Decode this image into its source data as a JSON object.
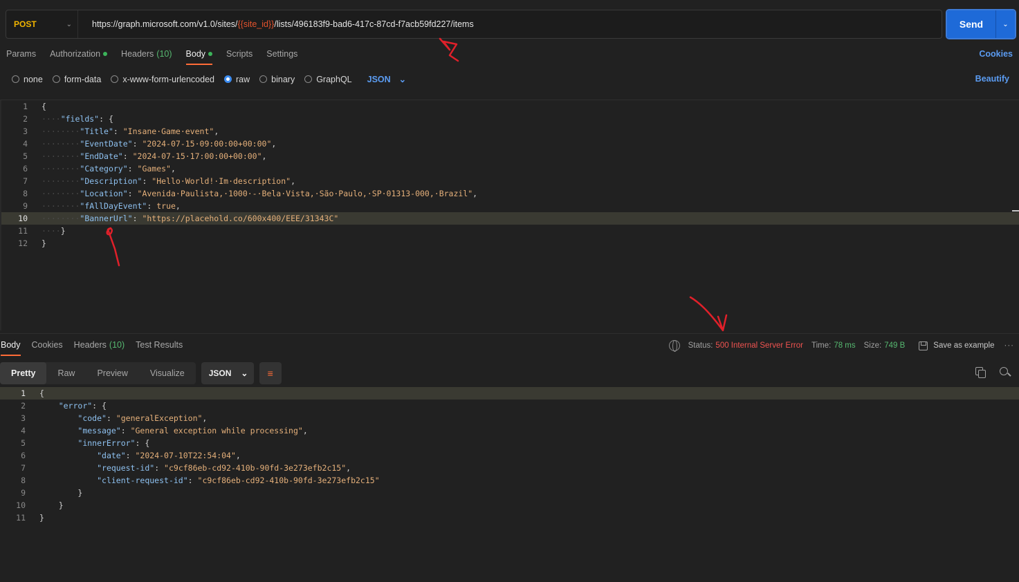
{
  "request": {
    "method": "POST",
    "url_prefix": "https://graph.microsoft.com/v1.0/sites/",
    "url_variable": "{{site_id}}",
    "url_suffix": "/lists/496183f9-bad6-417c-87cd-f7acb59fd227/items",
    "send_label": "Send"
  },
  "request_tabs": [
    {
      "label": "Params"
    },
    {
      "label": "Authorization",
      "dot": true
    },
    {
      "label": "Headers",
      "count": "(10)"
    },
    {
      "label": "Body",
      "dot": true,
      "active": true
    },
    {
      "label": "Scripts"
    },
    {
      "label": "Settings"
    }
  ],
  "cookies_label": "Cookies",
  "body_types": [
    {
      "label": "none",
      "selected": false
    },
    {
      "label": "form-data",
      "selected": false
    },
    {
      "label": "x-www-form-urlencoded",
      "selected": false
    },
    {
      "label": "raw",
      "selected": true
    },
    {
      "label": "binary",
      "selected": false
    },
    {
      "label": "GraphQL",
      "selected": false
    }
  ],
  "raw_format": "JSON",
  "beautify_label": "Beautify",
  "request_body": {
    "fields": [
      {
        "key": "Title",
        "value": "\"Insane Game event\""
      },
      {
        "key": "EventDate",
        "value": "\"2024-07-15 09:00:00+00:00\""
      },
      {
        "key": "EndDate",
        "value": "\"2024-07-15 17:00:00+00:00\""
      },
      {
        "key": "Category",
        "value": "\"Games\""
      },
      {
        "key": "Description",
        "value": "\"Hello World! Im description\""
      },
      {
        "key": "Location",
        "value": "\"Avenida Paulista, 1000 - Bela Vista, São Paulo, SP 01313-000, Brazil\""
      },
      {
        "key": "fAllDayEvent",
        "value": "true"
      },
      {
        "key": "BannerUrl",
        "value": "\"https://placehold.co/600x400/EEE/31343C\""
      }
    ]
  },
  "response_tabs": [
    {
      "label": "Body",
      "active": true
    },
    {
      "label": "Cookies"
    },
    {
      "label": "Headers",
      "count": "(10)"
    },
    {
      "label": "Test Results"
    }
  ],
  "response_status": {
    "status_label": "Status:",
    "status_value": "500 Internal Server Error",
    "time_label": "Time:",
    "time_value": "78 ms",
    "size_label": "Size:",
    "size_value": "749 B",
    "save_label": "Save as example",
    "more": "···"
  },
  "view_modes": [
    {
      "label": "Pretty",
      "active": true
    },
    {
      "label": "Raw"
    },
    {
      "label": "Preview"
    },
    {
      "label": "Visualize"
    }
  ],
  "response_format": "JSON",
  "response_body": {
    "code": "\"generalException\"",
    "message": "\"General exception while processing\"",
    "date": "\"2024-07-10T22:54:04\"",
    "request_id": "\"c9cf86eb-cd92-410b-90fd-3e273efb2c15\"",
    "client_request_id": "\"c9cf86eb-cd92-410b-90fd-3e273efb2c15\""
  },
  "colors": {
    "accent": "#ff6c37",
    "link": "#5b9cf2",
    "send": "#1e6ad8",
    "error": "#ef5350",
    "success": "#56b870",
    "annotation": "#e0202a"
  }
}
